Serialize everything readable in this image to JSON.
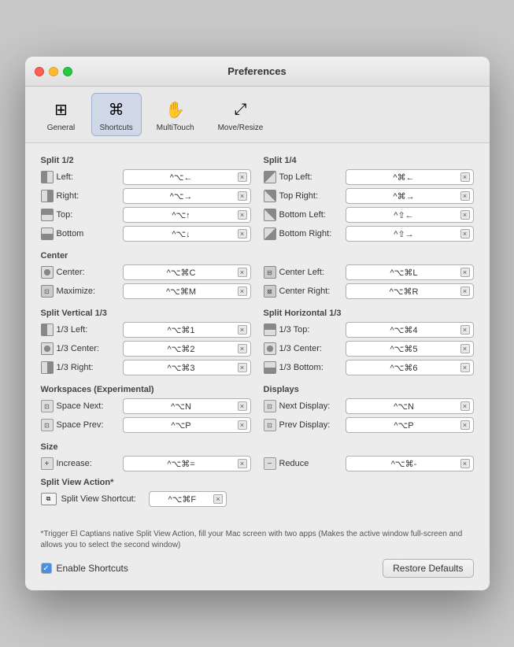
{
  "window": {
    "title": "Preferences"
  },
  "toolbar": {
    "items": [
      {
        "id": "general",
        "label": "General",
        "icon": "⊞"
      },
      {
        "id": "shortcuts",
        "label": "Shortcuts",
        "icon": "⌘",
        "active": true
      },
      {
        "id": "multitouch",
        "label": "MultiTouch",
        "icon": "✋"
      },
      {
        "id": "moveresize",
        "label": "Move/Resize",
        "icon": "⤢"
      }
    ]
  },
  "sections": {
    "split12": {
      "label": "Split 1/2",
      "rows": [
        {
          "icon": "L",
          "label": "Left:",
          "shortcut": "^⌥←"
        },
        {
          "icon": "R",
          "label": "Right:",
          "shortcut": "^⌥→"
        },
        {
          "icon": "T",
          "label": "Top:",
          "shortcut": "^⌥↑"
        },
        {
          "icon": "B",
          "label": "Bottom",
          "shortcut": "^⌥↓"
        }
      ]
    },
    "split14": {
      "label": "Split 1/4",
      "rows": [
        {
          "icon": "TL",
          "label": "Top Left:",
          "shortcut": "^⌘←"
        },
        {
          "icon": "TR",
          "label": "Top Right:",
          "shortcut": "^⌘→"
        },
        {
          "icon": "BL",
          "label": "Bottom Left:",
          "shortcut": "^⇧←"
        },
        {
          "icon": "BR",
          "label": "Bottom Right:",
          "shortcut": "^⇧→"
        }
      ]
    },
    "center": {
      "label": "Center",
      "rows": [
        {
          "icon": "C",
          "label": "Center:",
          "shortcut": "^⌥⌘C"
        },
        {
          "icon": "M",
          "label": "Maximize:",
          "shortcut": "^⌥⌘M"
        }
      ]
    },
    "centerRight": {
      "rows": [
        {
          "icon": "CL",
          "label": "Center Left:",
          "shortcut": "^⌥⌘L"
        },
        {
          "icon": "CR",
          "label": "Center Right:",
          "shortcut": "^⌥⌘R"
        }
      ]
    },
    "splitV13": {
      "label": "Split Vertical 1/3",
      "rows": [
        {
          "icon": "1",
          "label": "1/3 Left:",
          "shortcut": "^⌥⌘1"
        },
        {
          "icon": "2",
          "label": "1/3 Center:",
          "shortcut": "^⌥⌘2"
        },
        {
          "icon": "3",
          "label": "1/3 Right:",
          "shortcut": "^⌥⌘3"
        }
      ]
    },
    "splitH13": {
      "label": "Split Horizontal 1/3",
      "rows": [
        {
          "icon": "1",
          "label": "1/3 Top:",
          "shortcut": "^⌥⌘4"
        },
        {
          "icon": "2",
          "label": "1/3 Center:",
          "shortcut": "^⌥⌘5"
        },
        {
          "icon": "3",
          "label": "1/3 Bottom:",
          "shortcut": "^⌥⌘6"
        }
      ]
    },
    "workspaces": {
      "label": "Workspaces (Experimental)",
      "rows": [
        {
          "icon": "S",
          "label": "Space Next:",
          "shortcut": "^⌥N"
        },
        {
          "icon": "S",
          "label": "Space Prev:",
          "shortcut": "^⌥P"
        }
      ]
    },
    "displays": {
      "label": "Displays",
      "rows": [
        {
          "icon": "D",
          "label": "Next Display:",
          "shortcut": "^⌥N"
        },
        {
          "icon": "D",
          "label": "Prev Display:",
          "shortcut": "^⌥P"
        }
      ]
    },
    "size": {
      "label": "Size",
      "increase": {
        "icon": "+",
        "label": "Increase:",
        "shortcut": "^⌥⌘="
      },
      "reduce": {
        "icon": "-",
        "label": "Reduce",
        "shortcut": "^⌥⌘-"
      }
    },
    "splitView": {
      "label": "Split View Action*",
      "icon": "⧈",
      "label2": "Split View Shortcut:",
      "shortcut": "^⌥⌘F"
    }
  },
  "note": "*Trigger El Captians native Split View Action, fill your Mac screen with two apps (Makes the active window full-screen and allows you to select the second window)",
  "footer": {
    "checkbox_label": "Enable Shortcuts",
    "restore_label": "Restore Defaults",
    "checked": true
  },
  "clear_symbol": "×"
}
